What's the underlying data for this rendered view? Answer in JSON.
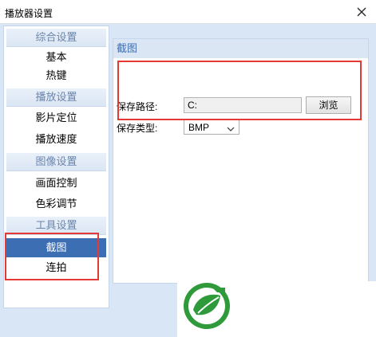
{
  "window": {
    "title": "播放器设置",
    "close_icon": "close-icon"
  },
  "sidebar": {
    "groups": [
      {
        "header": "综合设置",
        "items": [
          {
            "label": "基本",
            "selected": false
          },
          {
            "label": "热键",
            "selected": false
          }
        ]
      },
      {
        "header": "播放设置",
        "items": [
          {
            "label": "影片定位",
            "selected": false
          },
          {
            "label": "播放速度",
            "selected": false
          }
        ]
      },
      {
        "header": "图像设置",
        "items": [
          {
            "label": "画面控制",
            "selected": false
          },
          {
            "label": "色彩调节",
            "selected": false
          }
        ]
      },
      {
        "header": "工具设置",
        "items": [
          {
            "label": "截图",
            "selected": true
          },
          {
            "label": "连拍",
            "selected": false
          }
        ]
      }
    ]
  },
  "content": {
    "header": "截图",
    "save_path": {
      "label": "保存路径:",
      "value": "C:"
    },
    "browse_button": "浏览",
    "save_type": {
      "label": "保存类型:",
      "value": "BMP"
    }
  },
  "colors": {
    "accent": "#3b6eb2",
    "panel_header_text": "#3f6fb0",
    "annotation_red": "#e53935",
    "logo_green": "#2e9a3a"
  },
  "icons": {
    "logo": "leaf-logo-icon",
    "dropdown": "chevron-down-icon"
  }
}
